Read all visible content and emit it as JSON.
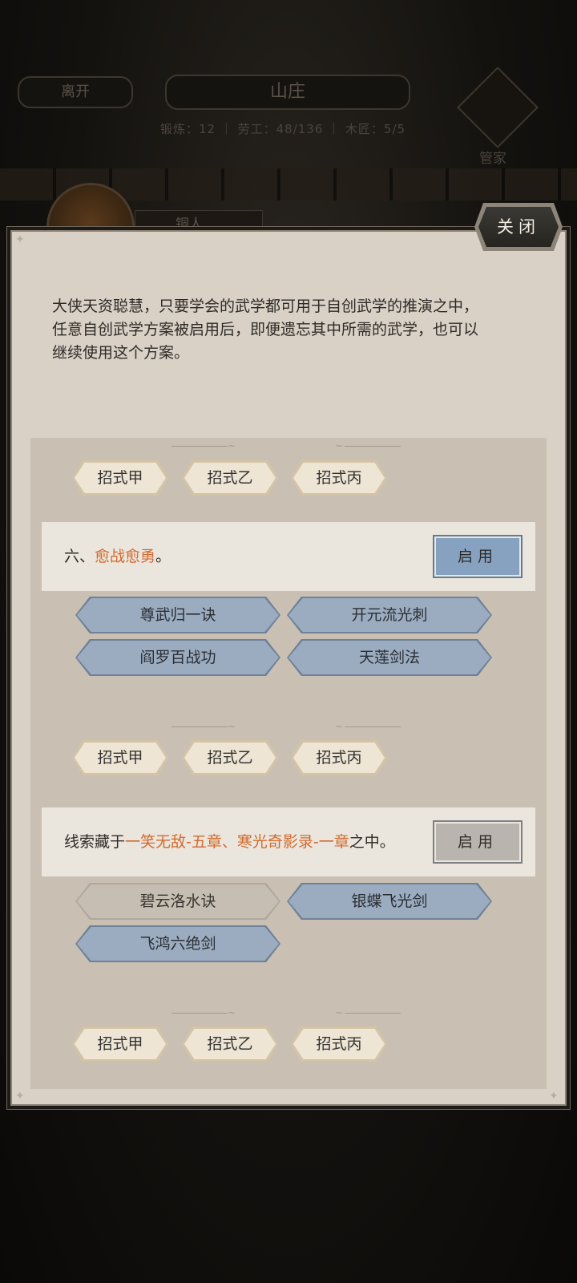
{
  "background": {
    "leave_label": "离开",
    "location_title": "山庄",
    "stats_text": "锻炼：12  ｜  劳工：48/136  ｜  木匠：5/5",
    "steward_label": "管家",
    "npc_label": "铜人"
  },
  "modal": {
    "close_label": "关闭",
    "intro_lines": [
      "大侠天资聪慧，只要学会的武学都可用于自创武学的推演之中，",
      "任意自创武学方案被启用后，即便遗忘其中所需的武学，也可以",
      "继续使用这个方案。"
    ]
  },
  "move_labels": [
    "招式甲",
    "招式乙",
    "招式丙"
  ],
  "plans": [
    {
      "prefix": "六、",
      "highlight": "愈战愈勇",
      "suffix": "。",
      "enable_label": "启用",
      "enable_state": "active",
      "skills": [
        {
          "label": "尊武归一诀",
          "locked": false
        },
        {
          "label": "开元流光刺",
          "locked": false
        },
        {
          "label": "阎罗百战功",
          "locked": false
        },
        {
          "label": "天莲剑法",
          "locked": false
        }
      ]
    },
    {
      "prefix": "线索藏于",
      "highlight": "一笑无敌-五章、寒光奇影录-一章",
      "suffix": "之中。",
      "enable_label": "启用",
      "enable_state": "disabled",
      "skills": [
        {
          "label": "碧云洛水诀",
          "locked": true
        },
        {
          "label": "银蝶飞光剑",
          "locked": false
        },
        {
          "label": "飞鸿六绝剑",
          "locked": false
        }
      ]
    }
  ],
  "colors": {
    "highlight": "#d26a2e",
    "skill_blue": "#9bacc0",
    "enable_active": "#86a2c0",
    "panel": "#d9d1c6"
  }
}
